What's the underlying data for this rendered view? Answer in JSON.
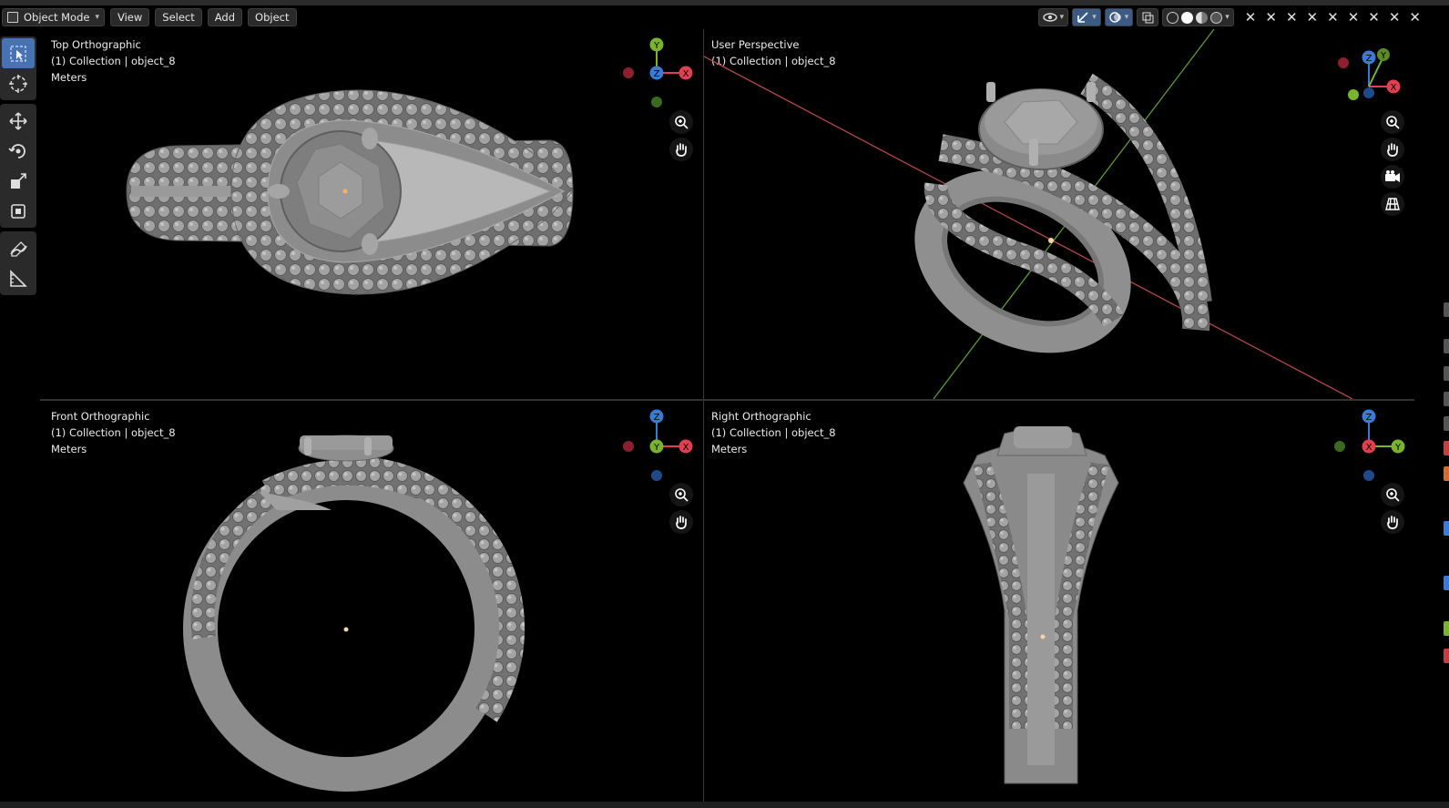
{
  "header": {
    "mode_label": "Object Mode",
    "menus": [
      "View",
      "Select",
      "Add",
      "Object"
    ]
  },
  "viewports": {
    "top": {
      "view": "Top Orthographic",
      "collection": "(1) Collection | object_8",
      "units": "Meters"
    },
    "persp": {
      "view": "User Perspective",
      "collection": "(1) Collection | object_8"
    },
    "front": {
      "view": "Front Orthographic",
      "collection": "(1) Collection | object_8",
      "units": "Meters"
    },
    "right": {
      "view": "Right Orthographic",
      "collection": "(1) Collection | object_8",
      "units": "Meters"
    }
  },
  "gizmo_labels": {
    "x": "X",
    "y": "Y",
    "z": "Z"
  },
  "colors": {
    "axis_x": "#e0404f",
    "axis_y": "#7ab42d",
    "axis_z": "#3a7bd5",
    "active_tool": "#4772b3",
    "model_gray": "#8a8a8a"
  },
  "icons": [
    "select-box-icon",
    "cursor-icon",
    "move-icon",
    "rotate-icon",
    "scale-icon",
    "transform-icon",
    "annotate-icon",
    "measure-icon",
    "zoom-icon",
    "hand-icon",
    "camera-icon",
    "grid-icon"
  ]
}
